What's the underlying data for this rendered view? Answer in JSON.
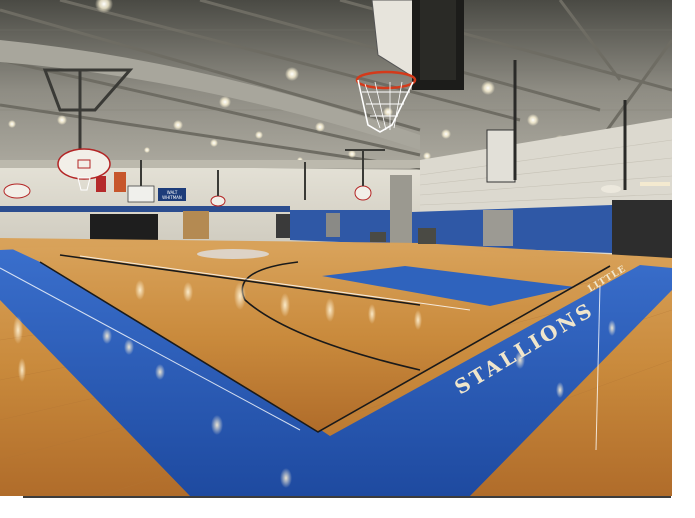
{
  "photo": {
    "floor_lettering": "STALLIONS",
    "floor_lettering_small": "LITTLE",
    "wall_sign_line1": "WALT",
    "wall_sign_line2": "WHITMAN",
    "colors": {
      "court_blue": "#2c5fb8",
      "wood": "#c98a3c",
      "wall_blue": "#2f58a6",
      "ceiling": "#9a9990",
      "wall": "#d9d6cc"
    },
    "icons": [
      "basketball-hoop-icon",
      "backboard-icon"
    ]
  }
}
